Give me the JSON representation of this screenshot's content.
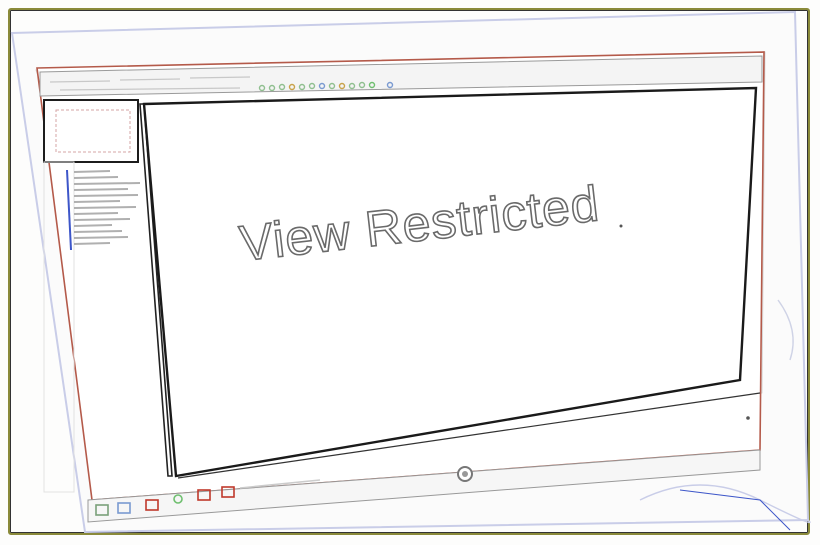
{
  "image": {
    "kind": "pencil-sketch style photo of a monitor",
    "screen_text": "View Restricted"
  },
  "colors": {
    "frame": "#8a8a3a",
    "outline": "#222222",
    "accent_red": "#c0392b",
    "accent_blue": "#3d56c9"
  }
}
